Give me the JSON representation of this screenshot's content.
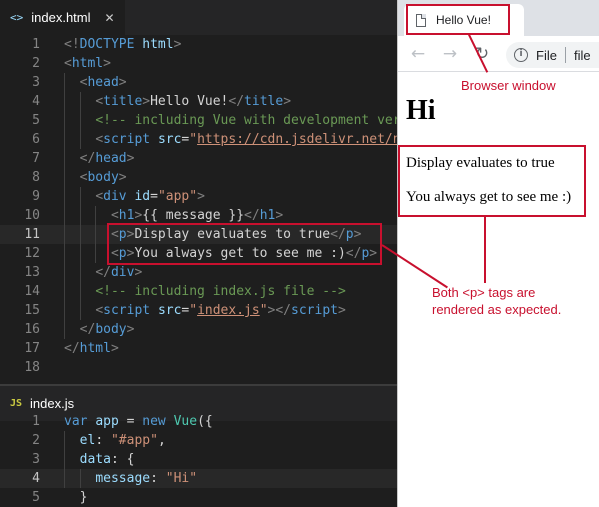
{
  "editor": {
    "html_tab": {
      "icon": "<>",
      "title": "index.html",
      "close": "✕"
    },
    "js_tab": {
      "icon": "JS",
      "title": "index.js"
    },
    "html_lines": [
      {
        "n": "1",
        "segments": [
          {
            "c": "t-bracket",
            "t": "<!"
          },
          {
            "c": "t-tag",
            "t": "DOCTYPE"
          },
          {
            "c": "t-text",
            "t": " "
          },
          {
            "c": "t-attr",
            "t": "html"
          },
          {
            "c": "t-bracket",
            "t": ">"
          }
        ]
      },
      {
        "n": "2",
        "segments": [
          {
            "c": "t-bracket",
            "t": "<"
          },
          {
            "c": "t-tag",
            "t": "html"
          },
          {
            "c": "t-bracket",
            "t": ">"
          }
        ]
      },
      {
        "n": "3",
        "segments": [
          {
            "c": "t-text",
            "t": "  "
          },
          {
            "c": "t-bracket",
            "t": "<"
          },
          {
            "c": "t-tag",
            "t": "head"
          },
          {
            "c": "t-bracket",
            "t": ">"
          }
        ]
      },
      {
        "n": "4",
        "segments": [
          {
            "c": "t-text",
            "t": "    "
          },
          {
            "c": "t-bracket",
            "t": "<"
          },
          {
            "c": "t-tag",
            "t": "title"
          },
          {
            "c": "t-bracket",
            "t": ">"
          },
          {
            "c": "t-text",
            "t": "Hello Vue!"
          },
          {
            "c": "t-bracket",
            "t": "</"
          },
          {
            "c": "t-tag",
            "t": "title"
          },
          {
            "c": "t-bracket",
            "t": ">"
          }
        ]
      },
      {
        "n": "5",
        "segments": [
          {
            "c": "t-text",
            "t": "    "
          },
          {
            "c": "t-cmt",
            "t": "<!-- including Vue with development ver"
          }
        ]
      },
      {
        "n": "6",
        "segments": [
          {
            "c": "t-text",
            "t": "    "
          },
          {
            "c": "t-bracket",
            "t": "<"
          },
          {
            "c": "t-tag",
            "t": "script"
          },
          {
            "c": "t-text",
            "t": " "
          },
          {
            "c": "t-attr",
            "t": "src"
          },
          {
            "c": "t-text",
            "t": "="
          },
          {
            "c": "t-str",
            "t": "\""
          },
          {
            "c": "t-str t-url",
            "t": "https://cdn.jsdelivr.net/n"
          }
        ]
      },
      {
        "n": "7",
        "segments": [
          {
            "c": "t-text",
            "t": "  "
          },
          {
            "c": "t-bracket",
            "t": "</"
          },
          {
            "c": "t-tag",
            "t": "head"
          },
          {
            "c": "t-bracket",
            "t": ">"
          }
        ]
      },
      {
        "n": "8",
        "segments": [
          {
            "c": "t-text",
            "t": "  "
          },
          {
            "c": "t-bracket",
            "t": "<"
          },
          {
            "c": "t-tag",
            "t": "body"
          },
          {
            "c": "t-bracket",
            "t": ">"
          }
        ]
      },
      {
        "n": "9",
        "segments": [
          {
            "c": "t-text",
            "t": "    "
          },
          {
            "c": "t-bracket",
            "t": "<"
          },
          {
            "c": "t-tag",
            "t": "div"
          },
          {
            "c": "t-text",
            "t": " "
          },
          {
            "c": "t-attr",
            "t": "id"
          },
          {
            "c": "t-text",
            "t": "="
          },
          {
            "c": "t-str",
            "t": "\"app\""
          },
          {
            "c": "t-bracket",
            "t": ">"
          }
        ]
      },
      {
        "n": "10",
        "segments": [
          {
            "c": "t-text",
            "t": "      "
          },
          {
            "c": "t-bracket",
            "t": "<"
          },
          {
            "c": "t-tag",
            "t": "h1"
          },
          {
            "c": "t-bracket",
            "t": ">"
          },
          {
            "c": "t-text",
            "t": "{{ message }}"
          },
          {
            "c": "t-bracket",
            "t": "</"
          },
          {
            "c": "t-tag",
            "t": "h1"
          },
          {
            "c": "t-bracket",
            "t": ">"
          }
        ]
      },
      {
        "n": "11",
        "current": true,
        "segments": [
          {
            "c": "t-text",
            "t": "      "
          },
          {
            "c": "t-bracket",
            "t": "<"
          },
          {
            "c": "t-tag",
            "t": "p"
          },
          {
            "c": "t-bracket",
            "t": ">"
          },
          {
            "c": "t-text",
            "t": "Display evaluates to true"
          },
          {
            "c": "t-bracket",
            "t": "</"
          },
          {
            "c": "t-tag",
            "t": "p"
          },
          {
            "c": "t-bracket",
            "t": ">"
          }
        ]
      },
      {
        "n": "12",
        "segments": [
          {
            "c": "t-text",
            "t": "      "
          },
          {
            "c": "t-bracket",
            "t": "<"
          },
          {
            "c": "t-tag",
            "t": "p"
          },
          {
            "c": "t-bracket",
            "t": ">"
          },
          {
            "c": "t-text",
            "t": "You always get to see me :)"
          },
          {
            "c": "t-bracket",
            "t": "</"
          },
          {
            "c": "t-tag",
            "t": "p"
          },
          {
            "c": "t-bracket",
            "t": ">"
          }
        ]
      },
      {
        "n": "13",
        "segments": [
          {
            "c": "t-text",
            "t": "    "
          },
          {
            "c": "t-bracket",
            "t": "</"
          },
          {
            "c": "t-tag",
            "t": "div"
          },
          {
            "c": "t-bracket",
            "t": ">"
          }
        ]
      },
      {
        "n": "14",
        "segments": [
          {
            "c": "t-text",
            "t": "    "
          },
          {
            "c": "t-cmt",
            "t": "<!-- including index.js file -->"
          }
        ]
      },
      {
        "n": "15",
        "segments": [
          {
            "c": "t-text",
            "t": "    "
          },
          {
            "c": "t-bracket",
            "t": "<"
          },
          {
            "c": "t-tag",
            "t": "script"
          },
          {
            "c": "t-text",
            "t": " "
          },
          {
            "c": "t-attr",
            "t": "src"
          },
          {
            "c": "t-text",
            "t": "="
          },
          {
            "c": "t-str",
            "t": "\""
          },
          {
            "c": "t-str t-url",
            "t": "index.js"
          },
          {
            "c": "t-str",
            "t": "\""
          },
          {
            "c": "t-bracket",
            "t": "></"
          },
          {
            "c": "t-tag",
            "t": "script"
          },
          {
            "c": "t-bracket",
            "t": ">"
          }
        ]
      },
      {
        "n": "16",
        "segments": [
          {
            "c": "t-text",
            "t": "  "
          },
          {
            "c": "t-bracket",
            "t": "</"
          },
          {
            "c": "t-tag",
            "t": "body"
          },
          {
            "c": "t-bracket",
            "t": ">"
          }
        ]
      },
      {
        "n": "17",
        "segments": [
          {
            "c": "t-bracket",
            "t": "</"
          },
          {
            "c": "t-tag",
            "t": "html"
          },
          {
            "c": "t-bracket",
            "t": ">"
          }
        ]
      },
      {
        "n": "18",
        "segments": []
      }
    ],
    "js_lines": [
      {
        "n": "1",
        "segments": [
          {
            "c": "t-kw",
            "t": "var"
          },
          {
            "c": "t-text",
            "t": " "
          },
          {
            "c": "t-var",
            "t": "app"
          },
          {
            "c": "t-text",
            "t": " = "
          },
          {
            "c": "t-kw",
            "t": "new"
          },
          {
            "c": "t-text",
            "t": " "
          },
          {
            "c": "t-fn",
            "t": "Vue"
          },
          {
            "c": "t-text",
            "t": "({"
          }
        ]
      },
      {
        "n": "2",
        "segments": [
          {
            "c": "t-text",
            "t": "  "
          },
          {
            "c": "t-var",
            "t": "el"
          },
          {
            "c": "t-text",
            "t": ": "
          },
          {
            "c": "t-str",
            "t": "\"#app\""
          },
          {
            "c": "t-text",
            "t": ","
          }
        ]
      },
      {
        "n": "3",
        "segments": [
          {
            "c": "t-text",
            "t": "  "
          },
          {
            "c": "t-var",
            "t": "data"
          },
          {
            "c": "t-text",
            "t": ": {"
          }
        ]
      },
      {
        "n": "4",
        "current": true,
        "segments": [
          {
            "c": "t-text",
            "t": "    "
          },
          {
            "c": "t-var",
            "t": "message"
          },
          {
            "c": "t-text",
            "t": ": "
          },
          {
            "c": "t-str",
            "t": "\"Hi\""
          }
        ]
      },
      {
        "n": "5",
        "segments": [
          {
            "c": "t-text",
            "t": "  }"
          }
        ]
      }
    ]
  },
  "browser": {
    "tab_title": "Hello Vue!",
    "omnibox_info_label": "File",
    "omnibox_url": "file",
    "nav": {
      "back": "←",
      "forward": "→",
      "reload": "↻"
    },
    "page": {
      "heading": "Hi",
      "paragraphs": [
        "Display evaluates to true",
        "You always get to see me :)"
      ]
    }
  },
  "annotations": {
    "browser_window": "Browser window",
    "both_tags": "Both <p> tags are\nrendered as expected."
  },
  "colors": {
    "annotation": "#c8102e",
    "editor_bg": "#1e1e1e",
    "tag": "#569cd6",
    "attribute": "#9cdcfe",
    "string": "#ce9178",
    "comment": "#6a9955",
    "class_name": "#4ec9b0"
  }
}
